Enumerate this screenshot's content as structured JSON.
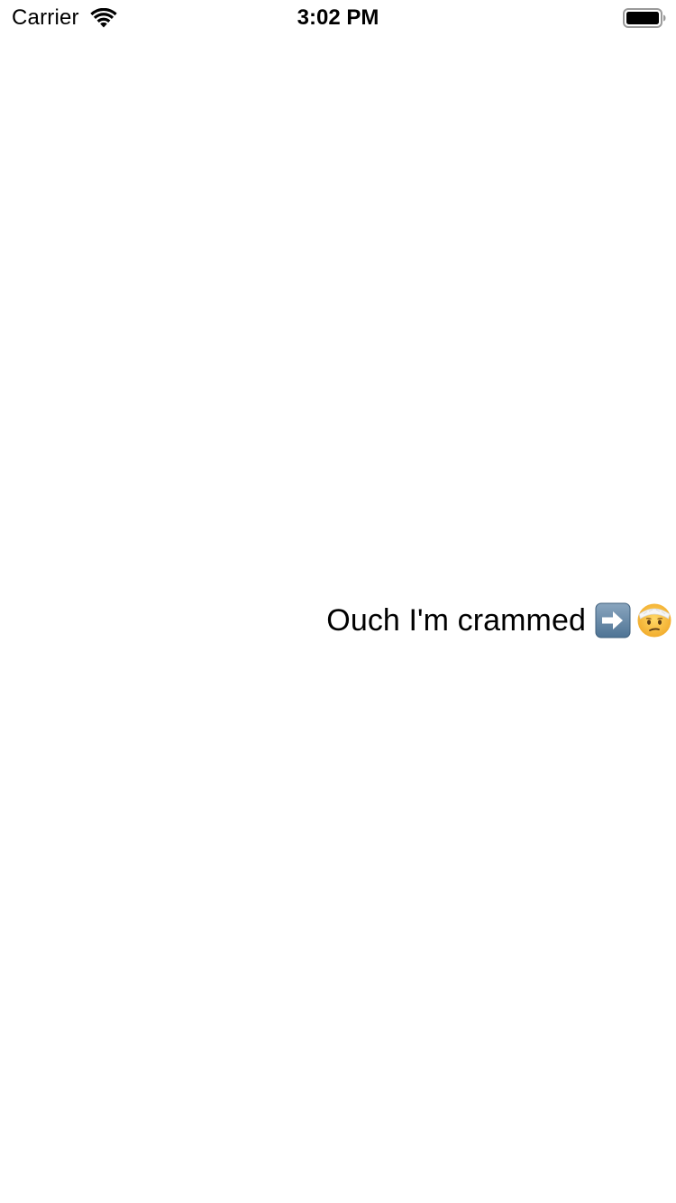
{
  "status_bar": {
    "carrier": "Carrier",
    "time": "3:02 PM",
    "wifi_icon": "wifi-icon",
    "battery_icon": "battery-full-icon"
  },
  "content": {
    "label": "Ouch I'm crammed",
    "emoji_1": "right-arrow-emoji-icon",
    "emoji_2": "face-with-head-bandage-emoji-icon"
  },
  "colors": {
    "background": "#ffffff",
    "text": "#000000",
    "arrow_tile": "#5b7f9e",
    "face": "#f5c14a"
  }
}
